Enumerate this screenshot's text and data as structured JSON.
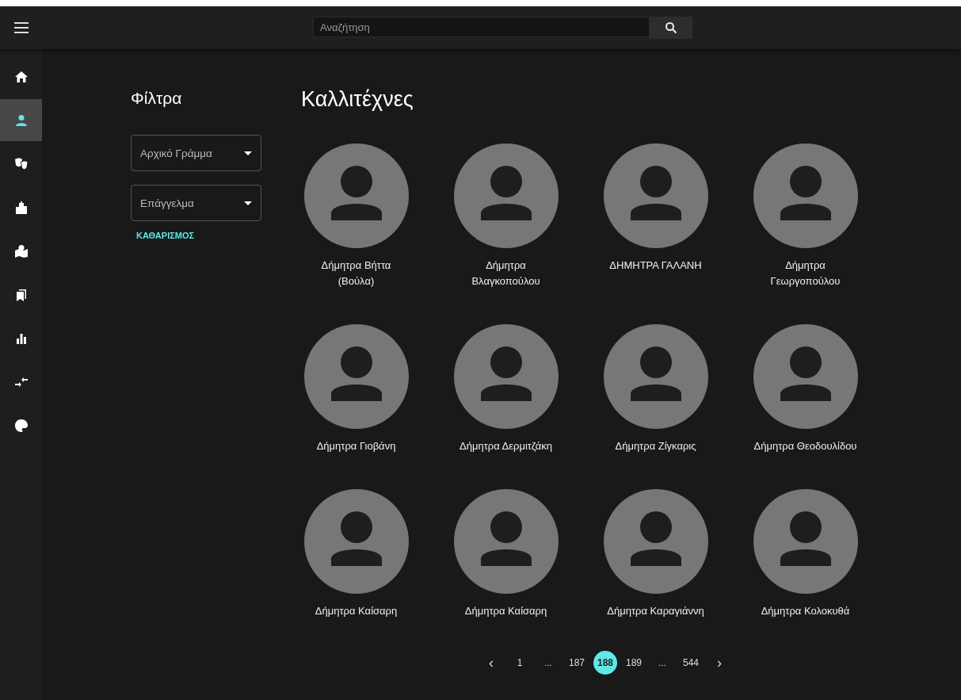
{
  "search": {
    "placeholder": "Αναζήτηση"
  },
  "nav": [
    {
      "kind": "home",
      "selected": false
    },
    {
      "kind": "person",
      "selected": true
    },
    {
      "kind": "masks",
      "selected": false
    },
    {
      "kind": "buildings",
      "selected": false
    },
    {
      "kind": "map",
      "selected": false
    },
    {
      "kind": "bookmarks",
      "selected": false
    },
    {
      "kind": "chart",
      "selected": false
    },
    {
      "kind": "arrows",
      "selected": false
    },
    {
      "kind": "palette",
      "selected": false
    }
  ],
  "filters": {
    "title": "Φίλτρα",
    "selects": [
      "Αρχικό Γράμμα",
      "Επάγγελμα"
    ],
    "clear": "ΚΑΘΑΡΙΣΜΟΣ"
  },
  "title": "Καλλιτέχνες",
  "artists": [
    {
      "name": "Δήμητρα Βήττα\n(Βούλα)"
    },
    {
      "name": "Δήμητρα\nΒλαγκοπούλου"
    },
    {
      "name": "ΔΗΜΗΤΡΑ ΓΑΛΑΝΗ"
    },
    {
      "name": "Δήμητρα\nΓεωργοπούλου"
    },
    {
      "name": "Δήμητρα Γιοβάνη"
    },
    {
      "name": "Δήμητρα Δερμιτζάκη"
    },
    {
      "name": "Δήμητρα Ζίγκαρις"
    },
    {
      "name": "Δήμητρα Θεοδουλίδου"
    },
    {
      "name": "Δήμητρα Καίσαρη"
    },
    {
      "name": "Δήμητρα Καίσαρη"
    },
    {
      "name": "Δήμητρα Καραγιάννη"
    },
    {
      "name": "Δήμητρα Κολοκυθά"
    }
  ],
  "pagination": {
    "prev": "‹",
    "next": "›",
    "pages": [
      {
        "label": "1",
        "kind": "page",
        "selected": false
      },
      {
        "label": "...",
        "kind": "ellipsis"
      },
      {
        "label": "187",
        "kind": "page",
        "selected": false
      },
      {
        "label": "188",
        "kind": "page",
        "selected": true
      },
      {
        "label": "189",
        "kind": "page",
        "selected": false
      },
      {
        "label": "...",
        "kind": "ellipsis"
      },
      {
        "label": "544",
        "kind": "page",
        "selected": false
      }
    ]
  }
}
